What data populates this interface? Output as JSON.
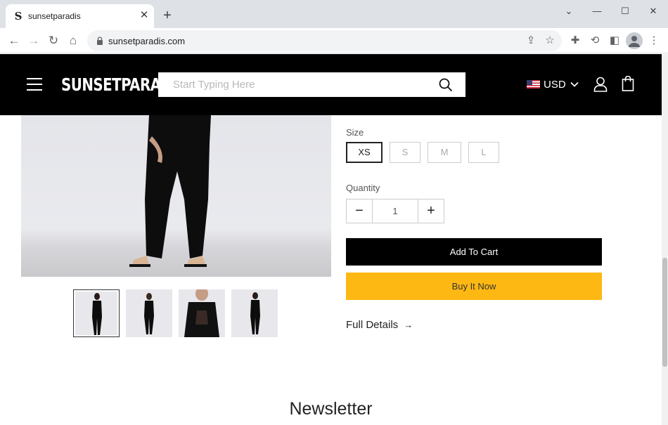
{
  "browser": {
    "tab_title": "sunsetparadis",
    "favicon_glyph": "S",
    "url": "sunsetparadis.com",
    "icons": [
      "back-icon",
      "forward-icon",
      "reload-icon",
      "home-icon",
      "lock-icon",
      "share-icon",
      "star-icon",
      "extensions-icon",
      "sync-icon",
      "sidepanel-icon",
      "profile-icon",
      "menu-icon"
    ]
  },
  "header": {
    "logo": "SUNSETPARADIS",
    "search_placeholder": "Start Typing Here",
    "currency": "USD"
  },
  "product": {
    "size_label": "Size",
    "sizes": [
      "XS",
      "S",
      "M",
      "L"
    ],
    "selected_size": "XS",
    "quantity_label": "Quantity",
    "quantity": "1",
    "add_to_cart": "Add To Cart",
    "buy_now": "Buy It Now",
    "full_details": "Full Details",
    "full_details_arrow": "→"
  },
  "footer": {
    "newsletter_title": "Newsletter"
  },
  "colors": {
    "header_bg": "#000000",
    "buy_button": "#fdb813",
    "cart_button": "#000000"
  }
}
